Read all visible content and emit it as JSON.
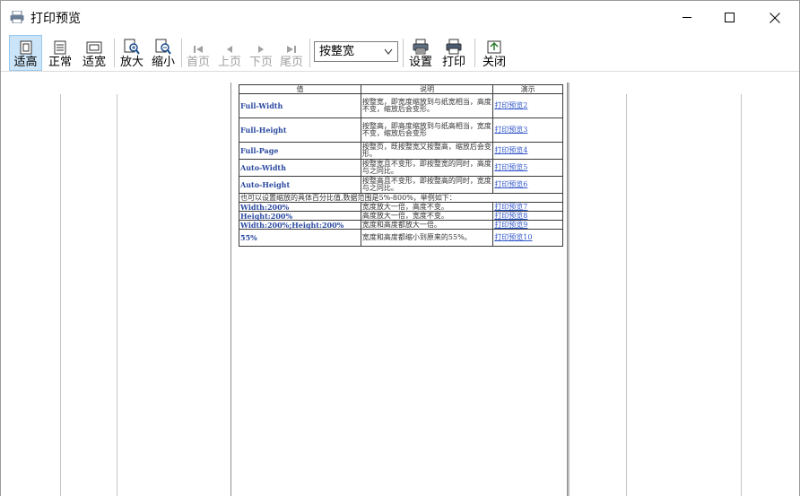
{
  "window": {
    "title": "打印预览"
  },
  "toolbar": {
    "buttons": [
      {
        "label": "适高",
        "icon": "fit-height-icon",
        "active": true,
        "disabled": false
      },
      {
        "label": "正常",
        "icon": "normal-view-icon",
        "active": false,
        "disabled": false
      },
      {
        "label": "适宽",
        "icon": "fit-width-icon",
        "active": false,
        "disabled": false
      },
      {
        "label": "放大",
        "icon": "zoom-in-icon",
        "active": false,
        "disabled": false
      },
      {
        "label": "缩小",
        "icon": "zoom-out-icon",
        "active": false,
        "disabled": false
      },
      {
        "label": "首页",
        "icon": "first-page-icon",
        "active": false,
        "disabled": true
      },
      {
        "label": "上页",
        "icon": "prev-page-icon",
        "active": false,
        "disabled": true
      },
      {
        "label": "下页",
        "icon": "next-page-icon",
        "active": false,
        "disabled": true
      },
      {
        "label": "尾页",
        "icon": "last-page-icon",
        "active": false,
        "disabled": true
      },
      {
        "label": "设置",
        "icon": "printer-settings-icon",
        "active": false,
        "disabled": false
      },
      {
        "label": "打印",
        "icon": "printer-icon",
        "active": false,
        "disabled": false
      },
      {
        "label": "关闭",
        "icon": "close-folder-icon",
        "active": false,
        "disabled": false
      }
    ],
    "zoom_select": {
      "value": "按整宽"
    }
  },
  "preview_table": {
    "headers": [
      "值",
      "说明",
      "演示"
    ],
    "rows": [
      {
        "value": "Full-Width",
        "desc": "按整宽，即宽度缩放到与纸宽相当，高度不变，缩放后会变形。",
        "link": "打印预览2"
      },
      {
        "value": "Full-Height",
        "desc": "按整高，即高度缩放到与纸高相当，宽度不变，缩放后会变形",
        "link": "打印预览3"
      },
      {
        "value": "Full-Page",
        "desc": "按整页，既按整宽又按整高，缩放后会变形。",
        "link": "打印预览4"
      },
      {
        "value": "Auto-Width",
        "desc": "按整宽且不变形，即按整宽的同时，高度与之同比。",
        "link": "打印预览5"
      },
      {
        "value": "Auto-Height",
        "desc": "按整高且不变形，即按整高的同时，宽度与之同比。",
        "link": "打印预览6"
      }
    ],
    "note": "也可以设置缩放的具体百分比值,数据范围是5%-800%，举例如下：",
    "rows2": [
      {
        "value": "Width:200%",
        "desc": "宽度放大一倍，高度不变。",
        "link": "打印预览7"
      },
      {
        "value": "Height:200%",
        "desc": "高度放大一倍，宽度不变。",
        "link": "打印预览8"
      },
      {
        "value": "Width:200%;Height:200%",
        "desc": "宽度和高度都放大一倍。",
        "link": "打印预览9"
      },
      {
        "value": "55%",
        "desc": "宽度和高度都缩小到原来的55%。",
        "link": "打印预览10"
      }
    ]
  },
  "colors": {
    "active_button": "#cce4f7",
    "link": "#2f55c9",
    "value_text": "#2b4aa0"
  }
}
